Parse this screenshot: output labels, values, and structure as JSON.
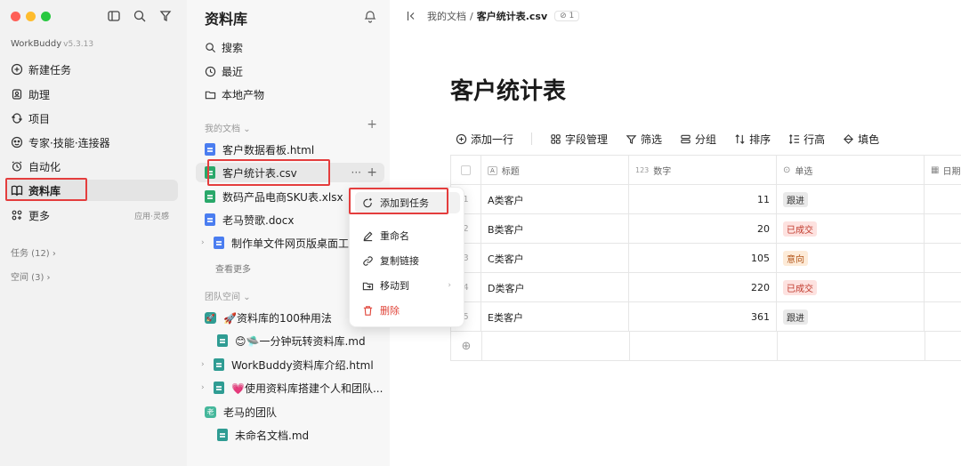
{
  "app": {
    "name": "WorkBuddy",
    "version": "v5.3.13"
  },
  "nav": {
    "items": [
      {
        "label": "新建任务",
        "icon": "plus-circle-icon"
      },
      {
        "label": "助理",
        "icon": "assistant-icon"
      },
      {
        "label": "项目",
        "icon": "project-icon"
      },
      {
        "label": "专家·技能·连接器",
        "icon": "expert-icon"
      },
      {
        "label": "自动化",
        "icon": "alarm-icon"
      },
      {
        "label": "资料库",
        "icon": "book-icon",
        "selected": true
      },
      {
        "label": "更多",
        "icon": "grid-icon",
        "hint": "应用·灵感"
      }
    ],
    "tasks": "任务 (12)",
    "spaces": "空间 (3)"
  },
  "library": {
    "title": "资料库",
    "search": "搜索",
    "recent": "最近",
    "local": "本地产物",
    "my_docs_header": "我的文档",
    "my_docs": [
      {
        "name": "客户数据看板.html",
        "color": "blue"
      },
      {
        "name": "客户统计表.csv",
        "color": "green",
        "hover": true,
        "more": "···"
      },
      {
        "name": "数码产品电商SKU表.xlsx",
        "color": "green"
      },
      {
        "name": "老马赞歌.docx",
        "color": "blue"
      },
      {
        "name": "制作单文件网页版桌面工",
        "color": "blue",
        "folder": true
      }
    ],
    "see_more": "查看更多",
    "team_header": "团队空间",
    "team": [
      {
        "name": "🚀资料库的100种用法",
        "kind": "space",
        "color": "#2f9c93",
        "glyph": "🚀"
      },
      {
        "name": "😊🛸一分钟玩转资料库.md",
        "kind": "md",
        "indent": true
      },
      {
        "name": "WorkBuddy资料库介绍.html",
        "kind": "md",
        "indent": true,
        "folder": true
      },
      {
        "name": "💗使用资料库搭建个人和团队...",
        "kind": "md",
        "indent": true,
        "folder": true
      },
      {
        "name": "老马的团队",
        "kind": "space",
        "color": "#45b79b",
        "glyph": "老"
      },
      {
        "name": "未命名文档.md",
        "kind": "md",
        "indent": true
      }
    ]
  },
  "context_menu": {
    "items": [
      {
        "label": "添加到任务",
        "icon": "add-task-icon",
        "active": true
      },
      {
        "label": "重命名",
        "icon": "pencil-icon"
      },
      {
        "label": "复制链接",
        "icon": "link-icon"
      },
      {
        "label": "移动到",
        "icon": "move-folder-icon",
        "submenu": "›"
      },
      {
        "label": "删除",
        "icon": "trash-icon",
        "danger": true
      }
    ]
  },
  "main": {
    "breadcrumb": {
      "parent": "我的文档",
      "sep": "/",
      "current": "客户统计表.csv",
      "count": "1"
    },
    "title": "客户统计表",
    "toolbar": [
      "添加一行",
      "字段管理",
      "筛选",
      "分组",
      "排序",
      "行高",
      "填色"
    ],
    "columns": [
      {
        "label": "标题",
        "icon": "A"
      },
      {
        "label": "数字",
        "icon": "123"
      },
      {
        "label": "单选",
        "icon": "⊙"
      },
      {
        "label": "日期",
        "icon": "▦"
      }
    ],
    "rows": [
      {
        "n": "1",
        "title": "A类客户",
        "num": "11",
        "tag": "跟进",
        "tag_bg": "#e9e9e9",
        "tag_fg": "#333333"
      },
      {
        "n": "2",
        "title": "B类客户",
        "num": "20",
        "tag": "已成交",
        "tag_bg": "#fde2e0",
        "tag_fg": "#c0392b"
      },
      {
        "n": "3",
        "title": "C类客户",
        "num": "105",
        "tag": "意向",
        "tag_bg": "#fdebd8",
        "tag_fg": "#b3561a"
      },
      {
        "n": "4",
        "title": "D类客户",
        "num": "220",
        "tag": "已成交",
        "tag_bg": "#fde2e0",
        "tag_fg": "#c0392b"
      },
      {
        "n": "5",
        "title": "E类客户",
        "num": "361",
        "tag": "跟进",
        "tag_bg": "#e9e9e9",
        "tag_fg": "#333333"
      }
    ]
  },
  "colors": {
    "accent_red": "#e43d3d",
    "blue_file": "#4a7df0",
    "green_file": "#2aa86a"
  }
}
